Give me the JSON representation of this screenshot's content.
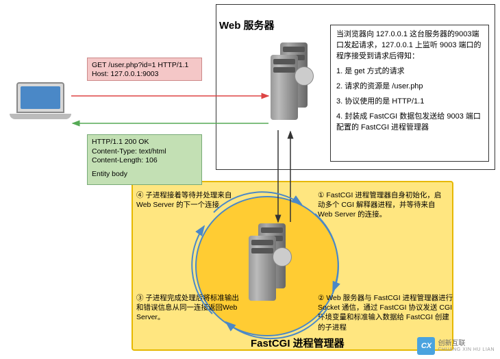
{
  "titles": {
    "web_server": "Web 服务器",
    "fastcgi": "FastCGI 进程管理器"
  },
  "request": {
    "line1": "GET /user.php?id=1 HTTP/1.1",
    "line2": "Host: 127.0.0.1:9003"
  },
  "response": {
    "line1": "HTTP/1.1 200 OK",
    "line2": "Content-Type: text/html",
    "line3": "Content-Length: 106",
    "line4": "Entity body"
  },
  "explain": {
    "intro": "当浏览器向 127.0.0.1 这台服务器的9003端口发起请求，127.0.0.1 上监听 9003 端口的程序接受到请求后得知：",
    "p1": "1. 是 get 方式的请求",
    "p2": "2. 请求的资源是 /user.php",
    "p3": "3. 协议使用的是 HTTP/1.1",
    "p4": "4. 封装成 FastCGI 数据包发送给 9003 端口配置的 FastCGI 进程管理器"
  },
  "steps": {
    "s1": "① FastCGI 进程管理器自身初始化，启动多个 CGI 解释器进程，并等待来自 Web Server 的连接。",
    "s2": "② Web 服务器与 FastCGI 进程管理器进行 Socket 通信，通过 FastCGI 协议发送 CGI 环境变量和标准输入数据给 FastCGI 创建的子进程",
    "s3": "③ 子进程完成处理后将标准输出和错误信息从同一连接返回Web Server。",
    "s4": "④ 子进程接着等待并处理来自 Web Server 的下一个连接"
  },
  "watermark": {
    "logo": "CX",
    "name": "创新互联",
    "sub": "CHUANG XIN HU LIAN"
  }
}
